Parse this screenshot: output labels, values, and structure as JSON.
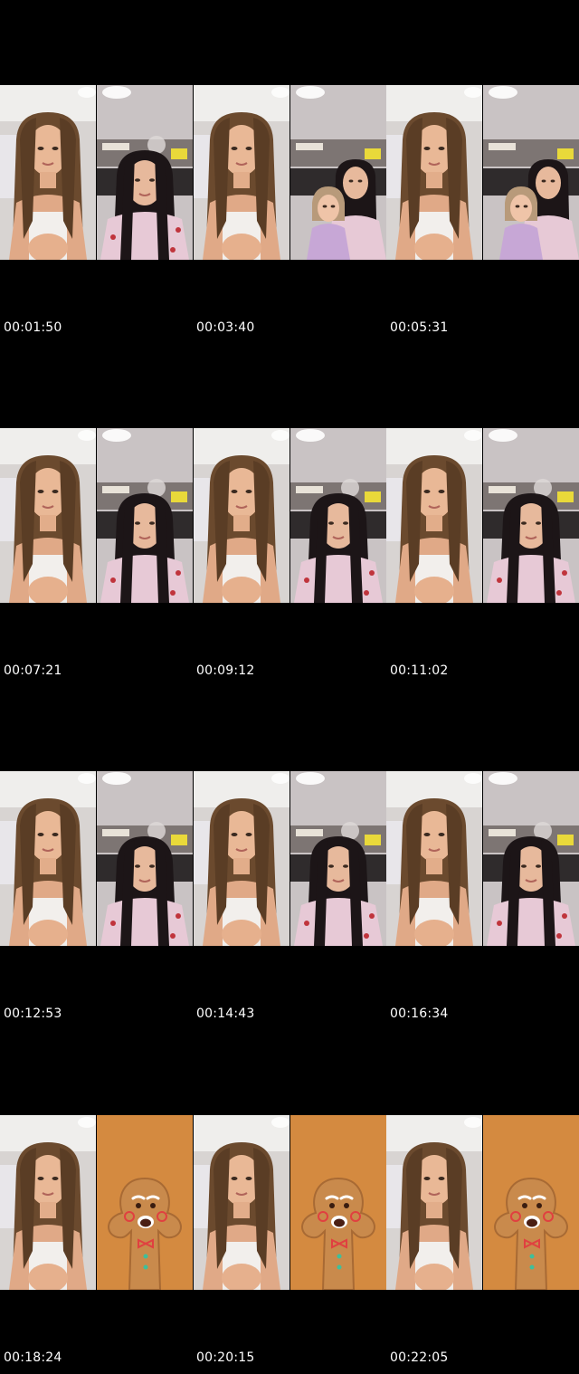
{
  "timestamps": [
    "00:01:50",
    "00:03:40",
    "00:05:31",
    "00:07:21",
    "00:09:12",
    "00:11:02",
    "00:12:53",
    "00:14:43",
    "00:16:34",
    "00:18:24",
    "00:20:15",
    "00:22:05"
  ],
  "thumbnails": [
    [
      "girl-white-top",
      "girl-pink-pajama",
      "girl-white-top",
      "two-girls",
      "girl-white-top",
      "two-girls"
    ],
    [
      "girl-white-top",
      "girl-pink-pajama",
      "girl-white-top",
      "girl-pink-pajama",
      "girl-white-top",
      "girl-pink-pajama"
    ],
    [
      "girl-white-top",
      "girl-pink-pajama",
      "girl-white-top",
      "girl-pink-pajama",
      "girl-white-top",
      "girl-pink-pajama"
    ],
    [
      "girl-white-top",
      "gingerbread-filter",
      "girl-white-top",
      "gingerbread-filter",
      "girl-white-top",
      "gingerbread-filter"
    ]
  ],
  "colors": {
    "background": "#000000",
    "room_wall": "#c9c3c4",
    "hair": "#6b4a2e",
    "pajama": "#e7c9d6",
    "gingerbread": "#c98a4c",
    "filter_bg": "#d48a40"
  }
}
